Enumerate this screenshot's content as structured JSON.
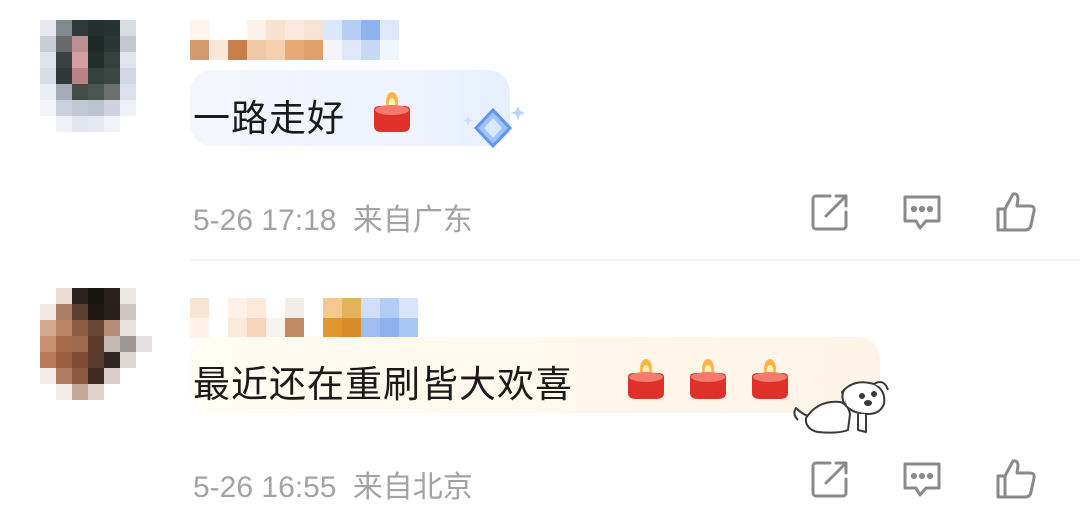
{
  "comments": [
    {
      "text": "一路走好",
      "emoji": [
        "candle"
      ],
      "time": "5-26 17:18",
      "location": "来自广东",
      "actions": [
        "share-icon",
        "reply-icon",
        "like-icon"
      ]
    },
    {
      "text": "最近还在重刷皆大欢喜",
      "emoji": [
        "candle",
        "candle",
        "candle"
      ],
      "time": "5-26 16:55",
      "location": "来自北京",
      "actions": [
        "share-icon",
        "reply-icon",
        "like-icon"
      ]
    }
  ],
  "colors": {
    "text": "#1a1a1a",
    "meta": "#a3a3a3",
    "bubble1": "#eef3fe",
    "bubble2": "#fff7ea",
    "candle_red": "#e0302a"
  }
}
